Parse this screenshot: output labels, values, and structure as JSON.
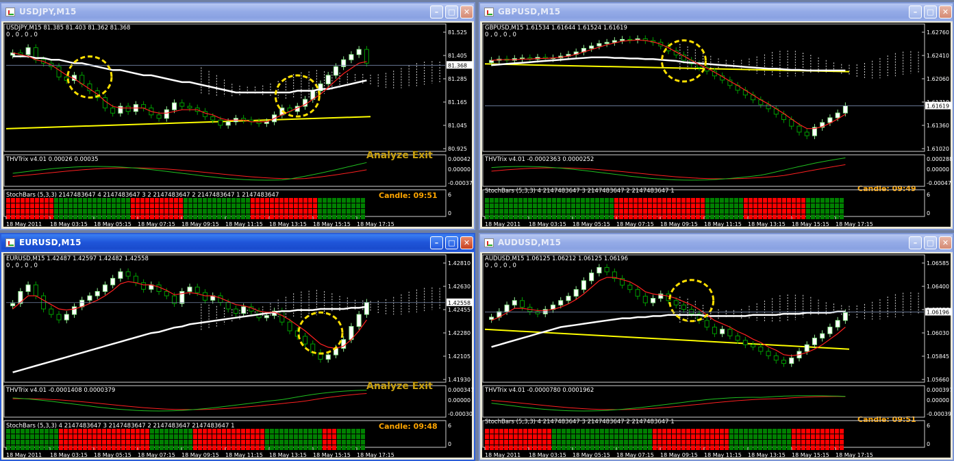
{
  "colors": {
    "title_active": "#1f55d9",
    "title_inactive": "#94abe7",
    "bull_candle": "#90ee90",
    "bear_candle": "#00a000",
    "ma_slow": "#ffffff",
    "ma_fast": "#ff2020",
    "trend_line": "#ffff00",
    "highlight_circle": "#ffe000",
    "candle_timer": "#ffa500",
    "stoch_red": "#ff0000",
    "stoch_green": "#008000"
  },
  "windows": [
    {
      "id": "usdjpy",
      "title": "USDJPY,M15",
      "active": false,
      "header_line": "USDJPY,M15  81.385 81.403 81.362 81.368",
      "sub_line": "0 , 0 , 0 , 0",
      "price_axis": [
        "81.525",
        "81.405",
        "81.285",
        "81.165",
        "81.045",
        "80.925"
      ],
      "current_price": "81.368",
      "price_range": [
        80.9,
        81.56
      ],
      "close_series": [
        81.44,
        81.43,
        81.47,
        81.4,
        81.38,
        81.36,
        81.3,
        81.28,
        81.31,
        81.26,
        81.22,
        81.18,
        81.12,
        81.09,
        81.13,
        81.1,
        81.14,
        81.12,
        81.08,
        81.06,
        81.11,
        81.15,
        81.13,
        81.12,
        81.1,
        81.07,
        81.05,
        81.02,
        81.04,
        81.06,
        81.05,
        81.04,
        81.03,
        81.04,
        81.08,
        81.12,
        81.1,
        81.13,
        81.17,
        81.22,
        81.26,
        81.31,
        81.36,
        81.4,
        81.43,
        81.46,
        81.38
      ],
      "fast_ma": [
        81.44,
        81.43,
        81.42,
        81.4,
        81.39,
        81.37,
        81.34,
        81.31,
        81.29,
        81.26,
        81.23,
        81.2,
        81.16,
        81.13,
        81.12,
        81.12,
        81.12,
        81.12,
        81.1,
        81.09,
        81.09,
        81.1,
        81.11,
        81.11,
        81.11,
        81.09,
        81.08,
        81.06,
        81.05,
        81.05,
        81.05,
        81.04,
        81.04,
        81.04,
        81.06,
        81.08,
        81.1,
        81.12,
        81.14,
        81.17,
        81.2,
        81.24,
        81.28,
        81.32,
        81.35,
        81.38,
        81.39
      ],
      "slow_ma": [
        81.42,
        81.42,
        81.42,
        81.41,
        81.41,
        81.4,
        81.4,
        81.39,
        81.38,
        81.38,
        81.37,
        81.36,
        81.35,
        81.34,
        81.34,
        81.33,
        81.32,
        81.31,
        81.31,
        81.3,
        81.29,
        81.28,
        81.27,
        81.27,
        81.26,
        81.25,
        81.24,
        81.23,
        81.22,
        81.21,
        81.21,
        81.21,
        81.21,
        81.21,
        81.21,
        81.21,
        81.21,
        81.22,
        81.22,
        81.22,
        81.23,
        81.23,
        81.24,
        81.25,
        81.26,
        81.27,
        81.28
      ],
      "trend_line": [
        81.0,
        81.07
      ],
      "circles": [
        [
          10,
          81.3
        ],
        [
          37,
          81.19
        ]
      ],
      "bg_text": "Analyze Exit",
      "trix_header": "THVTrix v4.01 0.00026 0.00035",
      "trix_axis": [
        "0.00042",
        "0.00000",
        "-0.00037"
      ],
      "stoch_header": "StochBars (5,3,3) 2147483647 4 2147483647 3 2 2147483647 2 2147483647 1 2147483647",
      "stoch_axis": [
        "6",
        "0"
      ],
      "candle_timer": "Candle:  09:51",
      "stoch_pattern": "RRRRRRRRRRGGGGGGGGGGGGGGGGGGRRRRRRRRRRRRGGGGGGGGGGGGGGGGRRRRRRRRRRRRRRRGGGGGGGGGGGG",
      "time_axis": [
        "18 May 2011",
        "18 May 03:15",
        "18 May 05:15",
        "18 May 07:15",
        "18 May 09:15",
        "18 May 11:15",
        "18 May 13:15",
        "18 May 15:15",
        "18 May 17:15"
      ]
    },
    {
      "id": "gbpusd",
      "title": "GBPUSD,M15",
      "active": false,
      "header_line": "GBPUSD,M15  1.61534 1.61644 1.61524 1.61619",
      "sub_line": "0 , 0 , 0 , 0",
      "price_axis": [
        "1.62760",
        "1.62410",
        "1.62060",
        "1.61710",
        "1.61360",
        "1.61020"
      ],
      "current_price": "1.61619",
      "price_range": [
        1.6095,
        1.6285
      ],
      "close_series": [
        1.6238,
        1.624,
        1.6238,
        1.6241,
        1.6242,
        1.624,
        1.6243,
        1.6241,
        1.6242,
        1.6245,
        1.6248,
        1.6252,
        1.6258,
        1.6262,
        1.6266,
        1.6268,
        1.6271,
        1.6273,
        1.6272,
        1.6274,
        1.6271,
        1.6268,
        1.6262,
        1.6254,
        1.6247,
        1.6238,
        1.6232,
        1.6226,
        1.622,
        1.6212,
        1.6205,
        1.6196,
        1.6188,
        1.618,
        1.6172,
        1.6164,
        1.6157,
        1.6148,
        1.6139,
        1.6128,
        1.6118,
        1.6112,
        1.6126,
        1.6134,
        1.6142,
        1.615,
        1.6162
      ],
      "fast_ma": [
        1.6238,
        1.6239,
        1.6239,
        1.6239,
        1.624,
        1.624,
        1.6241,
        1.6241,
        1.6242,
        1.6243,
        1.6245,
        1.6248,
        1.6252,
        1.6256,
        1.626,
        1.6264,
        1.6267,
        1.627,
        1.6271,
        1.6272,
        1.6271,
        1.6269,
        1.6265,
        1.6259,
        1.6252,
        1.6245,
        1.6238,
        1.6231,
        1.6225,
        1.6218,
        1.6211,
        1.6203,
        1.6196,
        1.6188,
        1.618,
        1.6172,
        1.6165,
        1.6157,
        1.6149,
        1.614,
        1.6131,
        1.6124,
        1.6124,
        1.6127,
        1.6133,
        1.614,
        1.6148
      ],
      "slow_ma": [
        1.623,
        1.6231,
        1.6232,
        1.6233,
        1.6234,
        1.6235,
        1.6236,
        1.6237,
        1.6238,
        1.6239,
        1.624,
        1.6241,
        1.6242,
        1.6243,
        1.6243,
        1.6243,
        1.6242,
        1.6242,
        1.6241,
        1.6241,
        1.624,
        1.624,
        1.6239,
        1.6238,
        1.6237,
        1.6235,
        1.6234,
        1.6233,
        1.6232,
        1.6231,
        1.623,
        1.6229,
        1.6228,
        1.6227,
        1.6226,
        1.6225,
        1.6224,
        1.6224,
        1.6223,
        1.6222,
        1.6222,
        1.6221,
        1.6221,
        1.6221,
        1.6221,
        1.6221,
        1.6221
      ],
      "trend_line": [
        1.6232,
        1.6219
      ],
      "circles": [
        [
          25,
          1.6237
        ]
      ],
      "bg_text": "",
      "trix_header": "THVTrix v4.01 -0.0002363 0.0000252",
      "trix_axis": [
        "0.000288",
        "0.00000",
        "-0.00047"
      ],
      "stoch_header": "StochBars (5,3,3) 4 2147483647 3 2147483647 2 2147483647 1",
      "stoch_axis": [
        "6",
        "0"
      ],
      "candle_timer": "Candle:  09:49",
      "stoch_pattern": "GGGGGGGGGGGGGGGGGGGGGGGGGGGGGGRRRRRRRRRRRRRRRRRRRRRRGGGGGGGGGRRRRRRRRRRRRRRGGGGGGGGGG",
      "time_axis": [
        "18 May 2011",
        "18 May 03:15",
        "18 May 05:15",
        "18 May 07:15",
        "18 May 09:15",
        "18 May 11:15",
        "18 May 13:15",
        "18 May 15:15",
        "18 May 17:15"
      ]
    },
    {
      "id": "eurusd",
      "title": "EURUSD,M15",
      "active": true,
      "header_line": "EURUSD,M15  1.42487 1.42597 1.42482 1.42558",
      "sub_line": "0 , 0 , 0 , 0",
      "price_axis": [
        "1.42810",
        "1.42630",
        "1.42455",
        "1.42280",
        "1.42105",
        "1.41930"
      ],
      "current_price": "1.42558",
      "price_range": [
        1.4188,
        1.4292
      ],
      "close_series": [
        1.4255,
        1.4266,
        1.4272,
        1.4262,
        1.425,
        1.4245,
        1.424,
        1.4245,
        1.4252,
        1.4258,
        1.4262,
        1.4266,
        1.4272,
        1.4278,
        1.4284,
        1.428,
        1.4274,
        1.4268,
        1.4272,
        1.4266,
        1.4262,
        1.4255,
        1.4266,
        1.427,
        1.4265,
        1.4258,
        1.4262,
        1.4256,
        1.425,
        1.4246,
        1.4252,
        1.4248,
        1.4242,
        1.4244,
        1.4248,
        1.4238,
        1.423,
        1.4225,
        1.4218,
        1.421,
        1.4204,
        1.4208,
        1.4214,
        1.4222,
        1.4234,
        1.4245,
        1.4256
      ],
      "fast_ma": [
        1.425,
        1.4256,
        1.4262,
        1.4262,
        1.4258,
        1.4254,
        1.425,
        1.4249,
        1.425,
        1.4252,
        1.4255,
        1.4258,
        1.4262,
        1.4267,
        1.4273,
        1.4275,
        1.4274,
        1.4272,
        1.4272,
        1.427,
        1.4267,
        1.4263,
        1.4264,
        1.4265,
        1.4264,
        1.4262,
        1.4262,
        1.426,
        1.4257,
        1.4254,
        1.4253,
        1.4251,
        1.4248,
        1.4247,
        1.4247,
        1.4244,
        1.424,
        1.4235,
        1.423,
        1.4224,
        1.4218,
        1.4215,
        1.4214,
        1.4216,
        1.4222,
        1.423,
        1.424
      ],
      "slow_ma": [
        1.4192,
        1.4194,
        1.4196,
        1.4198,
        1.42,
        1.4202,
        1.4204,
        1.4206,
        1.4208,
        1.421,
        1.4212,
        1.4214,
        1.4216,
        1.4218,
        1.422,
        1.4222,
        1.4224,
        1.4226,
        1.4228,
        1.4229,
        1.4231,
        1.4233,
        1.4234,
        1.4236,
        1.4237,
        1.4238,
        1.4239,
        1.424,
        1.4241,
        1.4242,
        1.4243,
        1.4244,
        1.4245,
        1.4246,
        1.4247,
        1.4248,
        1.4248,
        1.4249,
        1.4249,
        1.4249,
        1.425,
        1.425,
        1.425,
        1.425,
        1.4251,
        1.4251,
        1.4252
      ],
      "trend_line": null,
      "circles": [
        [
          40,
          1.4228
        ]
      ],
      "bg_text": "Analyze Exit",
      "trix_header": "THVTrix v4.01 -0.0001408 0.0000379",
      "trix_axis": [
        "0.000347",
        "0.00000",
        "-0.00030"
      ],
      "stoch_header": "StochBars (5,3,3) 4 2147483647 3 2147483647 2 2147483647 2147483647 1",
      "stoch_axis": [
        "6",
        "0"
      ],
      "candle_timer": "Candle:  09:48",
      "stoch_pattern": "GGGGGGGGGGGGRRRRRRRRRRRRRRRRRRRRRGGGGGGGGGGRRRRRRRRRRRRRRRRRGGGGGGGGGGGGGRRRRGGGGGGG",
      "time_axis": [
        "18 May 2011",
        "18 May 03:15",
        "18 May 05:15",
        "18 May 07:15",
        "18 May 09:15",
        "18 May 11:15",
        "18 May 13:15",
        "18 May 15:15",
        "18 May 17:15"
      ]
    },
    {
      "id": "audusd",
      "title": "AUDUSD,M15",
      "active": false,
      "header_line": "AUDUSD,M15  1.06125 1.06212 1.06125 1.06196",
      "sub_line": "0 , 0 , 0 , 0",
      "price_axis": [
        "1.06585",
        "1.06400",
        "1.06196",
        "1.06030",
        "1.05845",
        "1.05660"
      ],
      "current_price": "1.06196",
      "price_range": [
        1.0561,
        1.0664
      ],
      "close_series": [
        1.0615,
        1.062,
        1.0626,
        1.063,
        1.0624,
        1.062,
        1.0618,
        1.0622,
        1.0626,
        1.063,
        1.0634,
        1.064,
        1.0648,
        1.0655,
        1.066,
        1.0656,
        1.065,
        1.0644,
        1.064,
        1.0634,
        1.0628,
        1.0632,
        1.0636,
        1.063,
        1.0626,
        1.0622,
        1.0618,
        1.0612,
        1.0606,
        1.06,
        1.0604,
        1.0598,
        1.0594,
        1.059,
        1.0588,
        1.0584,
        1.058,
        1.0576,
        1.0573,
        1.0578,
        1.0584,
        1.059,
        1.0596,
        1.06,
        1.0606,
        1.0612,
        1.0619
      ],
      "fast_ma": [
        1.0612,
        1.0615,
        1.0619,
        1.0623,
        1.0623,
        1.0622,
        1.0621,
        1.0621,
        1.0622,
        1.0624,
        1.0627,
        1.0631,
        1.0636,
        1.0642,
        1.0648,
        1.0651,
        1.0651,
        1.0649,
        1.0647,
        1.0643,
        1.0638,
        1.0636,
        1.0635,
        1.0634,
        1.0632,
        1.0629,
        1.0626,
        1.0622,
        1.0617,
        1.0612,
        1.0609,
        1.0606,
        1.0602,
        1.0599,
        1.0595,
        1.0592,
        1.0588,
        1.0585,
        1.0581,
        1.058,
        1.0581,
        1.0583,
        1.0586,
        1.059,
        1.0595,
        1.06,
        1.0606
      ],
      "slow_ma": [
        1.0588,
        1.059,
        1.0592,
        1.0594,
        1.0596,
        1.0598,
        1.06,
        1.0602,
        1.0604,
        1.0606,
        1.0607,
        1.0608,
        1.0609,
        1.061,
        1.0611,
        1.0612,
        1.0613,
        1.0614,
        1.0614,
        1.0615,
        1.0615,
        1.0616,
        1.0616,
        1.0617,
        1.0617,
        1.0617,
        1.0617,
        1.0617,
        1.0616,
        1.0616,
        1.0616,
        1.0616,
        1.0616,
        1.0616,
        1.0617,
        1.0617,
        1.0617,
        1.0617,
        1.0618,
        1.0618,
        1.0618,
        1.0619,
        1.0619,
        1.0619,
        1.0619,
        1.062,
        1.062
      ],
      "trend_line": [
        1.0604,
        1.0586
      ],
      "circles": [
        [
          26,
          1.063
        ]
      ],
      "bg_text": "",
      "trix_header": "THVTrix v4.01 -0.0000780 0.0001962",
      "trix_axis": [
        "0.000397",
        "0.00000",
        "-0.00039"
      ],
      "stoch_header": "StochBars (5,3,3) 4 2147483647 3 2147483647 2 2147483647 1",
      "stoch_axis": [
        "6",
        "0"
      ],
      "candle_timer": "Candle:  09:51",
      "stoch_pattern": "RRRRRRRRRRRRRRRRGGGGGGGGGGGGGGGGGGGGGGGRRRRRRRRRRRRRRRRRRRGGGGGGGGGGGGGGGRRRRRRRRRRRRR",
      "time_axis": [
        "18 May 2011",
        "18 May 03:15",
        "18 May 05:15",
        "18 May 07:15",
        "18 May 09:15",
        "18 May 11:15",
        "18 May 13:15",
        "18 May 15:15",
        "18 May 17:15"
      ]
    }
  ]
}
